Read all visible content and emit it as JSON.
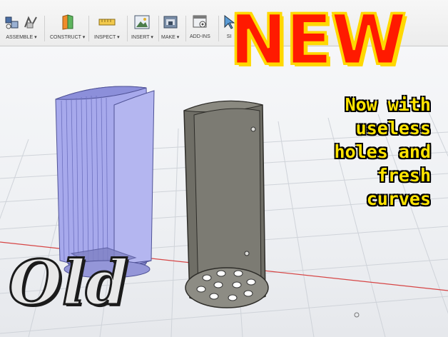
{
  "toolbar": {
    "items": [
      {
        "label": "ASSEMBLE ▾",
        "icon": "assemble-icon"
      },
      {
        "label": "CONSTRUCT ▾",
        "icon": "construct-plane-icon"
      },
      {
        "label": "INSPECT ▾",
        "icon": "measure-icon"
      },
      {
        "label": "INSERT ▾",
        "icon": "insert-image-icon"
      },
      {
        "label": "MAKE ▾",
        "icon": "make-3d-print-icon"
      },
      {
        "label": "ADD-INS",
        "icon": "addins-icon"
      },
      {
        "label": "SI",
        "icon": "select-icon"
      }
    ]
  },
  "overlay": {
    "headline": "NEW",
    "caption_lines": [
      "Now with",
      "useless",
      "holes and",
      "fresh",
      "curves"
    ],
    "old_label": "Old"
  },
  "colors": {
    "headline_fill": "#ff1a00",
    "headline_outline": "#ffd800",
    "caption_text": "#ffe400",
    "old_part": "#a7a9ec",
    "new_part": "#6f6e66"
  }
}
